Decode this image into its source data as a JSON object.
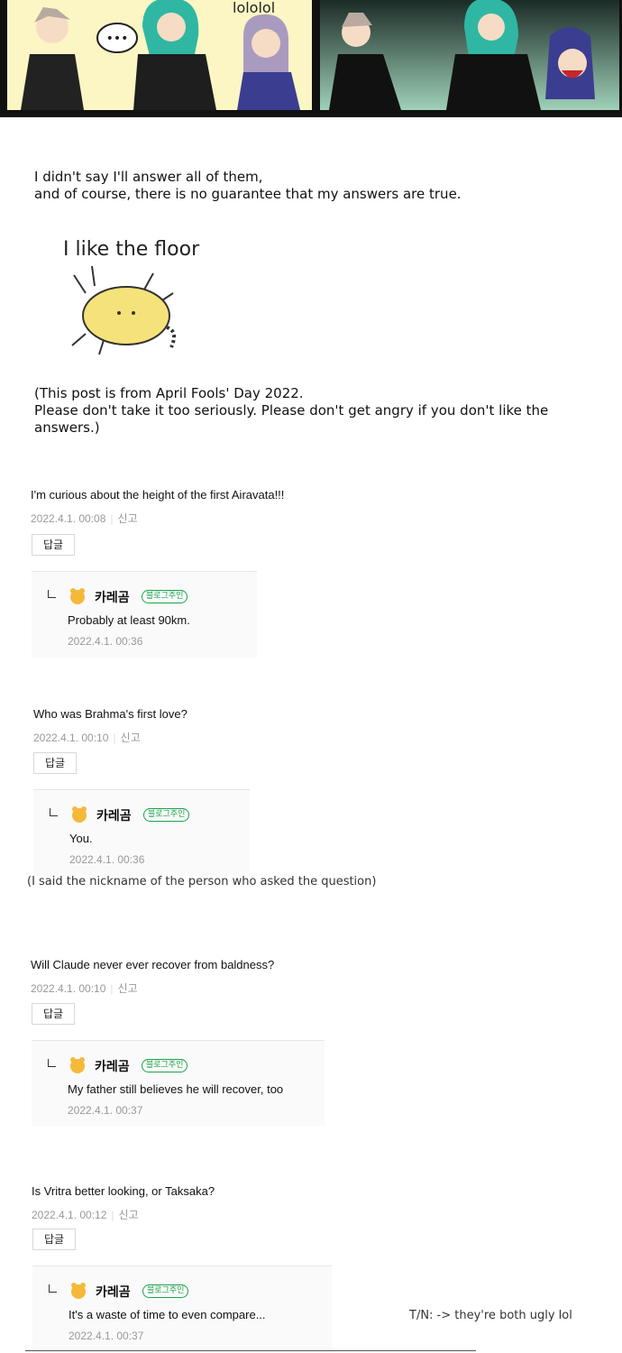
{
  "comic": {
    "speech_dots": "•••",
    "laugh_text": "lololol"
  },
  "intro": {
    "line1": "I didn't say I'll answer all of them,",
    "line2": "and of course, there is no guarantee that my answers are true.",
    "floor_caption": "I like the floor",
    "note_line1": "(This post is from April Fools' Day 2022.",
    "note_line2": "Please don't take it too seriously. Please don't get angry if you don't like the",
    "note_line3": "answers.)"
  },
  "report_label": "신고",
  "reply_button_label": "답글",
  "owner": {
    "name": "카레곰",
    "badge": "블로그주인"
  },
  "comments": [
    {
      "question": "I'm curious about the height of the first Airavata!!!",
      "date": "2022.4.1. 00:08",
      "reply": "Probably at least 90km.",
      "reply_date": "2022.4.1. 00:36"
    },
    {
      "question": "Who was Brahma's first love?",
      "date": "2022.4.1. 00:10",
      "reply": "You.",
      "reply_date": "2022.4.1. 00:36",
      "note": "(I said the nickname of the person who asked the question)"
    },
    {
      "question": "Will Claude never ever recover from baldness?",
      "date": "2022.4.1. 00:10",
      "reply": "My father still believes he will recover, too",
      "reply_date": "2022.4.1. 00:37"
    },
    {
      "question": "Is Vritra better looking, or Taksaka?",
      "date": "2022.4.1. 00:12",
      "reply": "It's a waste of time to even compare...",
      "reply_date": "2022.4.1. 00:37",
      "note": "T/N: -> they're both ugly lol"
    }
  ]
}
